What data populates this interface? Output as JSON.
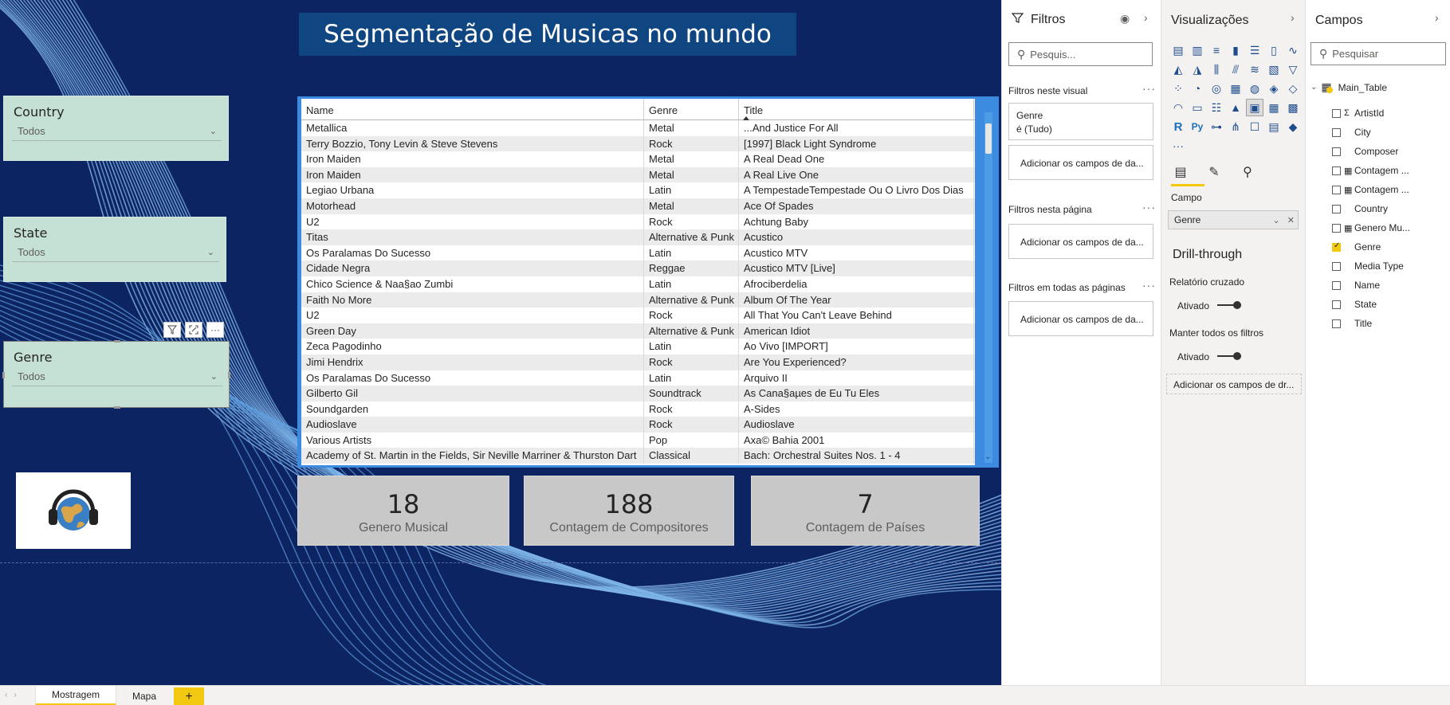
{
  "report": {
    "title": "Segmentação de Musicas no mundo"
  },
  "slicers": {
    "country": {
      "title": "Country",
      "value": "Todos"
    },
    "state": {
      "title": "State",
      "value": "Todos"
    },
    "genre": {
      "title": "Genre",
      "value": "Todos"
    }
  },
  "table": {
    "columns": [
      "Name",
      "Genre",
      "Title"
    ],
    "rows": [
      [
        "Metallica",
        "Metal",
        "...And Justice For All"
      ],
      [
        "Terry Bozzio, Tony Levin & Steve Stevens",
        "Rock",
        "[1997] Black Light Syndrome"
      ],
      [
        "Iron Maiden",
        "Metal",
        "A Real Dead One"
      ],
      [
        "Iron Maiden",
        "Metal",
        "A Real Live One"
      ],
      [
        "Legiao Urbana",
        "Latin",
        "A TempestadeTempestade Ou O Livro Dos Dias"
      ],
      [
        "Motorhead",
        "Metal",
        "Ace Of Spades"
      ],
      [
        "U2",
        "Rock",
        "Achtung Baby"
      ],
      [
        "Titas",
        "Alternative & Punk",
        "Acustico"
      ],
      [
        "Os Paralamas Do Sucesso",
        "Latin",
        "Acustico MTV"
      ],
      [
        "Cidade Negra",
        "Reggae",
        "Acustico MTV [Live]"
      ],
      [
        "Chico Science & Naa§ao Zumbi",
        "Latin",
        "Afrociberdelia"
      ],
      [
        "Faith No More",
        "Alternative & Punk",
        "Album Of The Year"
      ],
      [
        "U2",
        "Rock",
        "All That You Can't Leave Behind"
      ],
      [
        "Green Day",
        "Alternative & Punk",
        "American Idiot"
      ],
      [
        "Zeca Pagodinho",
        "Latin",
        "Ao Vivo [IMPORT]"
      ],
      [
        "Jimi Hendrix",
        "Rock",
        "Are You Experienced?"
      ],
      [
        "Os Paralamas Do Sucesso",
        "Latin",
        "Arquivo II"
      ],
      [
        "Gilberto Gil",
        "Soundtrack",
        "As Cana§aµes de Eu Tu Eles"
      ],
      [
        "Soundgarden",
        "Rock",
        "A-Sides"
      ],
      [
        "Audioslave",
        "Rock",
        "Audioslave"
      ],
      [
        "Various Artists",
        "Pop",
        "Axa© Bahia 2001"
      ],
      [
        "Academy of St. Martin in the Fields, Sir Neville Marriner & Thurston Dart",
        "Classical",
        "Bach: Orchestral Suites Nos. 1 - 4"
      ]
    ]
  },
  "cards": [
    {
      "value": "18",
      "label": "Genero Musical"
    },
    {
      "value": "188",
      "label": "Contagem de Compositores"
    },
    {
      "value": "7",
      "label": "Contagem de Países"
    }
  ],
  "filters_pane": {
    "title": "Filtros",
    "search_placeholder": "Pesquis...",
    "section_visual": "Filtros neste visual",
    "genre_filter_name": "Genre",
    "genre_filter_value": "é (Tudo)",
    "add_fields": "Adicionar os campos de da...",
    "section_page": "Filtros nesta página",
    "section_all": "Filtros em todas as páginas"
  },
  "vis_pane": {
    "title": "Visualizações",
    "field_label": "Campo",
    "field_value": "Genre",
    "drill_title": "Drill-through",
    "cross_report": "Relatório cruzado",
    "cross_state": "Ativado",
    "keep_filters": "Manter todos os filtros",
    "keep_state": "Ativado",
    "add_drill": "Adicionar os campos de dr..."
  },
  "fields_pane": {
    "title": "Campos",
    "search_placeholder": "Pesquisar",
    "table_name": "Main_Table",
    "fields": [
      {
        "label": "ArtistId",
        "icon": "Σ",
        "checked": false
      },
      {
        "label": "City",
        "icon": "",
        "checked": false
      },
      {
        "label": "Composer",
        "icon": "",
        "checked": false
      },
      {
        "label": "Contagem ...",
        "icon": "▦",
        "checked": false
      },
      {
        "label": "Contagem ...",
        "icon": "▦",
        "checked": false
      },
      {
        "label": "Country",
        "icon": "",
        "checked": false
      },
      {
        "label": "Genero Mu...",
        "icon": "▦",
        "checked": false
      },
      {
        "label": "Genre",
        "icon": "",
        "checked": true
      },
      {
        "label": "Media Type",
        "icon": "",
        "checked": false
      },
      {
        "label": "Name",
        "icon": "",
        "checked": false
      },
      {
        "label": "State",
        "icon": "",
        "checked": false
      },
      {
        "label": "Title",
        "icon": "",
        "checked": false
      }
    ]
  },
  "page_tabs": {
    "tab1": "Mostragem",
    "tab2": "Mapa",
    "add": "+"
  },
  "colors": {
    "canvas_bg": "#0d2463",
    "accent": "#f2c811",
    "table_border": "#3b8ce0",
    "slicer_bg": "#c5e0d5"
  }
}
